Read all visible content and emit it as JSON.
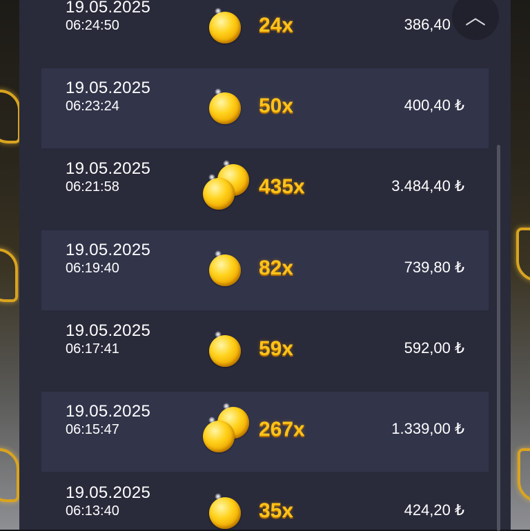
{
  "history": {
    "currency_symbol": "₺",
    "rows": [
      {
        "date": "19.05.2025",
        "time": "06:24:50",
        "multiplier": "24x",
        "amount": "386,40 ₺",
        "coins": "single"
      },
      {
        "date": "19.05.2025",
        "time": "06:23:24",
        "multiplier": "50x",
        "amount": "400,40 ₺",
        "coins": "single"
      },
      {
        "date": "19.05.2025",
        "time": "06:21:58",
        "multiplier": "435x",
        "amount": "3.484,40 ₺",
        "coins": "double"
      },
      {
        "date": "19.05.2025",
        "time": "06:19:40",
        "multiplier": "82x",
        "amount": "739,80 ₺",
        "coins": "single"
      },
      {
        "date": "19.05.2025",
        "time": "06:17:41",
        "multiplier": "59x",
        "amount": "592,00 ₺",
        "coins": "single"
      },
      {
        "date": "19.05.2025",
        "time": "06:15:47",
        "multiplier": "267x",
        "amount": "1.339,00 ₺",
        "coins": "double"
      },
      {
        "date": "19.05.2025",
        "time": "06:13:40",
        "multiplier": "35x",
        "amount": "424,20 ₺",
        "coins": "single"
      }
    ]
  },
  "scroll_up_button": {
    "icon": "chevron-up-icon",
    "glyph": "︿"
  },
  "colors": {
    "panel": "#292a3a",
    "row_shaded": "#32344a",
    "multiplier": "#ffc31a",
    "coin": "#ffd21c"
  }
}
